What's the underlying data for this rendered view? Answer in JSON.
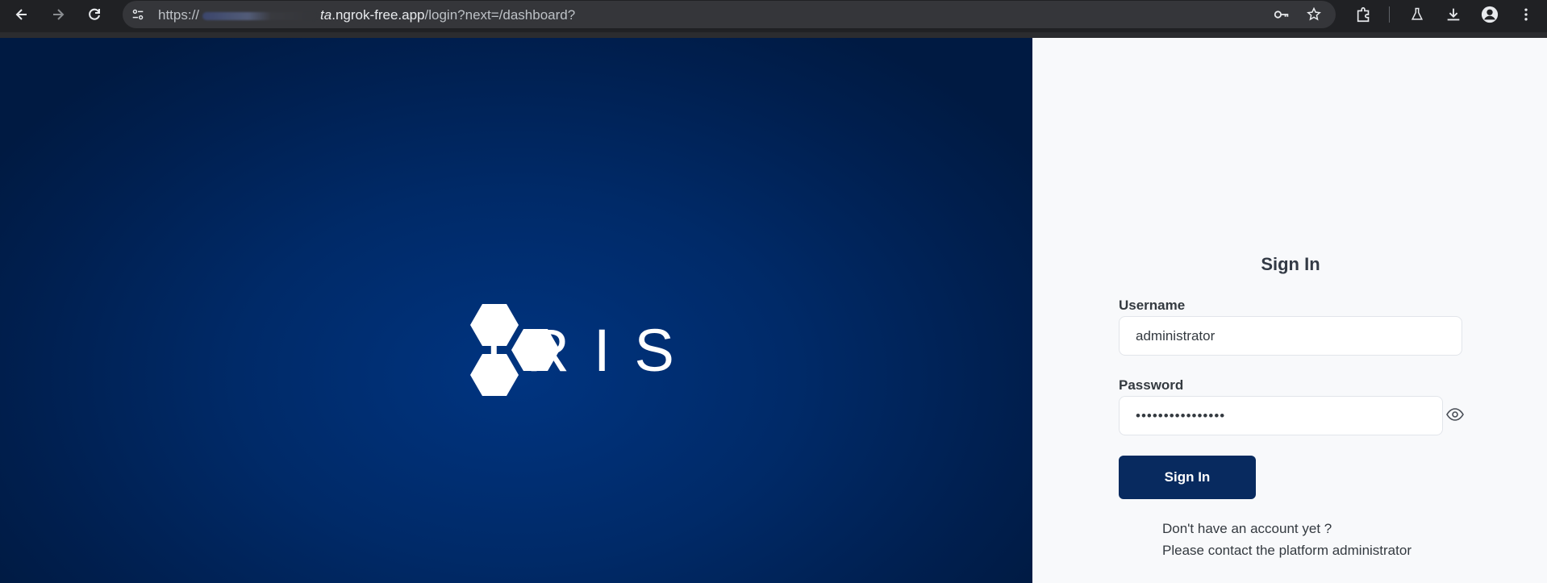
{
  "browser": {
    "url_scheme": "https://",
    "url_host_tail": ".ngrok-free.app",
    "url_host_tail_prefix": "ta",
    "url_path": "/login?next=/dashboard?",
    "icons": [
      "back-icon",
      "forward-icon",
      "reload-icon",
      "site-settings-icon",
      "key-icon",
      "star-icon",
      "extensions-icon",
      "labs-icon",
      "download-icon",
      "profile-icon",
      "menu-icon"
    ]
  },
  "brand": {
    "name": "IRIS",
    "colors": {
      "panel": "#002a68",
      "logo": "#ffffff"
    }
  },
  "login": {
    "title": "Sign In",
    "username_label": "Username",
    "username_value": "administrator",
    "password_label": "Password",
    "password_value": "••••••••••••••••",
    "submit_label": "Sign In",
    "no_account_text": "Don't have an account yet ?",
    "contact_text": "Please contact the platform administrator",
    "colors": {
      "button": "#082a5f",
      "background": "#f8f9fb"
    }
  }
}
